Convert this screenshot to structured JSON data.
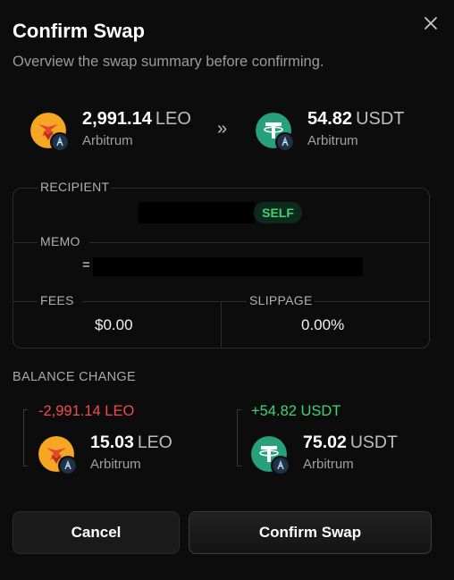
{
  "header": {
    "title": "Confirm Swap",
    "subtitle": "Overview the swap summary before confirming."
  },
  "swap": {
    "from": {
      "amount": "2,991.14",
      "symbol": "LEO",
      "network": "Arbitrum",
      "icon": "leo-token-icon",
      "chain_icon": "arbitrum-icon"
    },
    "arrow": "»",
    "to": {
      "amount": "54.82",
      "symbol": "USDT",
      "network": "Arbitrum",
      "icon": "tether-token-icon",
      "chain_icon": "arbitrum-icon"
    }
  },
  "details": {
    "recipient_label": "RECIPIENT",
    "self_badge": "SELF",
    "memo_label": "MEMO",
    "memo_prefix": "=",
    "fees_label": "FEES",
    "fees_value": "$0.00",
    "slippage_label": "SLIPPAGE",
    "slippage_value": "0.00%"
  },
  "balance_change": {
    "title": "BALANCE CHANGE",
    "from": {
      "delta": "-2,991.14 LEO",
      "amount": "15.03",
      "symbol": "LEO",
      "network": "Arbitrum"
    },
    "to": {
      "delta": "+54.82 USDT",
      "amount": "75.02",
      "symbol": "USDT",
      "network": "Arbitrum"
    }
  },
  "actions": {
    "cancel_label": "Cancel",
    "confirm_label": "Confirm Swap"
  },
  "colors": {
    "negative": "#ef4b4b",
    "positive": "#3fd277",
    "leo_brand": "#f5a623",
    "tether_brand": "#26a17b"
  }
}
